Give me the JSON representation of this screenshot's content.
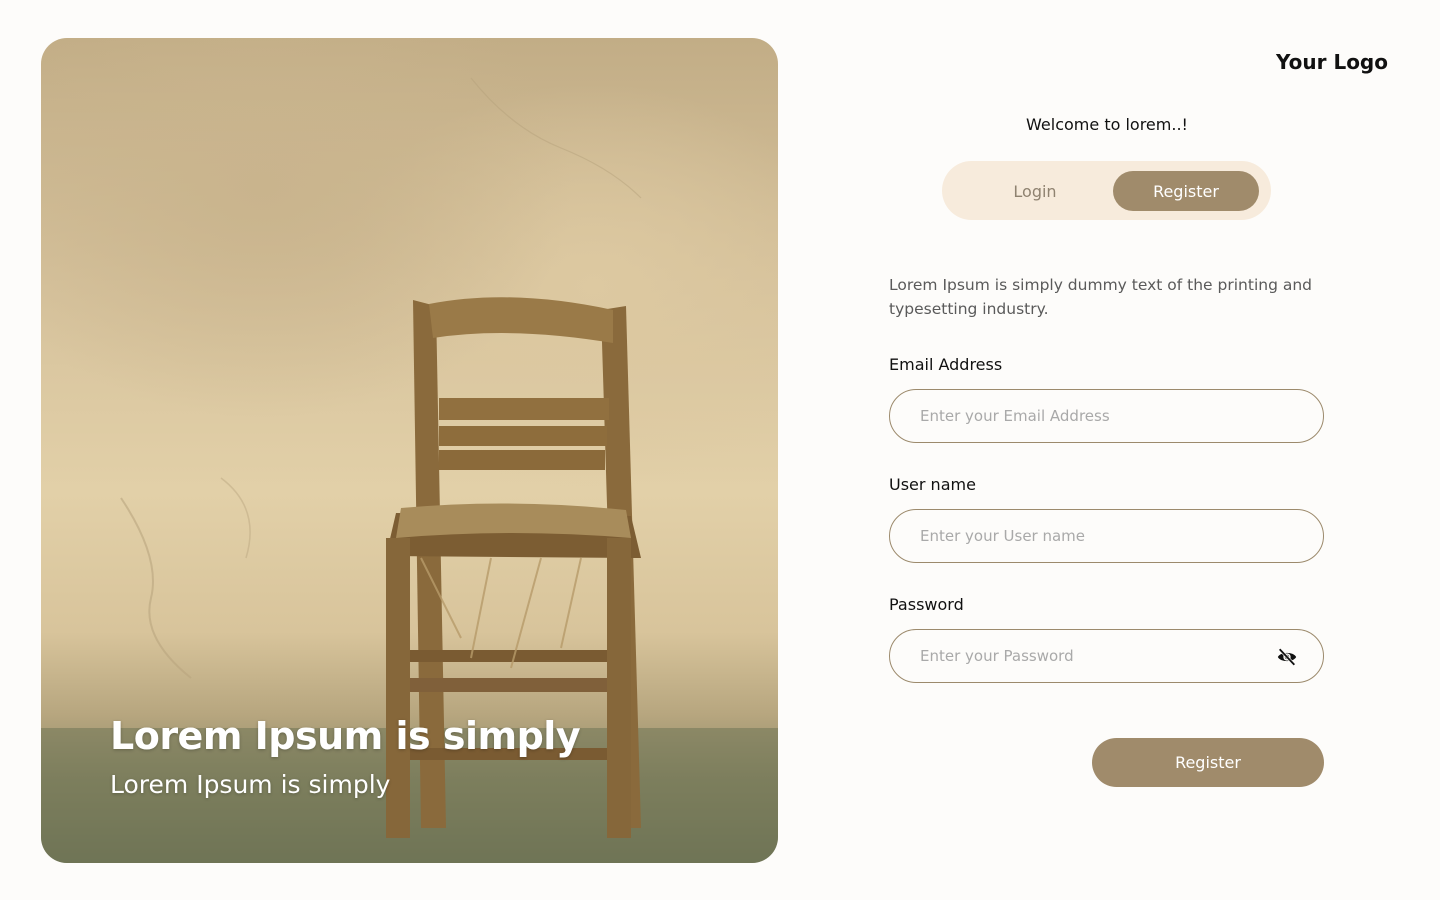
{
  "hero": {
    "image": "photo of an old wooden chair against a beige wall",
    "title": "Lorem Ipsum is simply",
    "subtitle": "Lorem Ipsum is simply"
  },
  "brand": {
    "logo": "Your Logo"
  },
  "form": {
    "welcome": "Welcome to lorem..!",
    "tabs": {
      "login": "Login",
      "register": "Register",
      "active": "register"
    },
    "intro": "Lorem Ipsum is simply dummy text of the printing and typesetting industry.",
    "email": {
      "label": "Email Address",
      "placeholder": "Enter your Email Address",
      "value": ""
    },
    "username": {
      "label": "User name",
      "placeholder": "Enter your User name",
      "value": ""
    },
    "password": {
      "label": "Password",
      "placeholder": "Enter your Password",
      "value": "",
      "toggle_icon": "eye-off-icon"
    },
    "submit_label": "Register"
  },
  "colors": {
    "accent": "#a08b6b",
    "toggle_bg": "#f7ebdc",
    "field_border": "#9c8a6c",
    "page_bg": "#fdfcfa"
  }
}
